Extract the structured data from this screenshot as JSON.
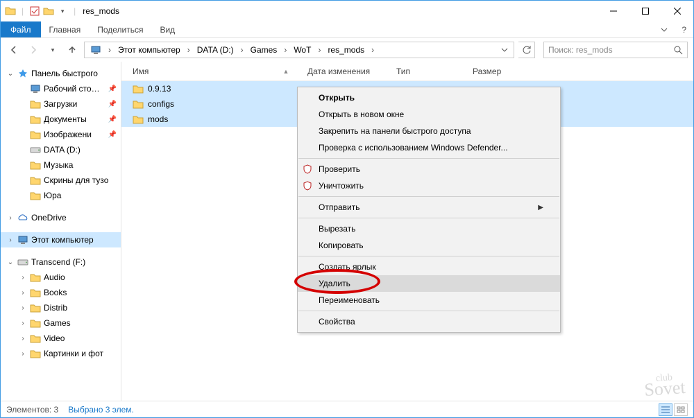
{
  "title": "res_mods",
  "ribbon": {
    "file": "Файл",
    "tabs": [
      "Главная",
      "Поделиться",
      "Вид"
    ]
  },
  "breadcrumbs": [
    "Этот компьютер",
    "DATA (D:)",
    "Games",
    "WoT",
    "res_mods"
  ],
  "search_placeholder": "Поиск: res_mods",
  "tree": {
    "quick": "Панель быстрого",
    "quick_items": [
      {
        "label": "Рабочий сто…",
        "type": "desktop",
        "pinned": true
      },
      {
        "label": "Загрузки",
        "type": "folder",
        "pinned": true
      },
      {
        "label": "Документы",
        "type": "folder",
        "pinned": true
      },
      {
        "label": "Изображени",
        "type": "folder",
        "pinned": true
      },
      {
        "label": "DATA (D:)",
        "type": "drive",
        "pinned": false
      },
      {
        "label": "Музыка",
        "type": "folder",
        "pinned": false
      },
      {
        "label": "Скрины для тузо",
        "type": "folder",
        "pinned": false
      },
      {
        "label": "Юра",
        "type": "folder",
        "pinned": false
      }
    ],
    "onedrive": "OneDrive",
    "thispc": "Этот компьютер",
    "transcend": "Transcend (F:)",
    "transcend_items": [
      "Audio",
      "Books",
      "Distrib",
      "Games",
      "Video",
      "Картинки и фот"
    ]
  },
  "columns": {
    "name": "Имя",
    "date": "Дата изменения",
    "type": "Тип",
    "size": "Размер"
  },
  "rows": [
    {
      "name": "0.9.13"
    },
    {
      "name": "configs"
    },
    {
      "name": "mods"
    }
  ],
  "ctx": {
    "open": "Открыть",
    "open_new": "Открыть в новом окне",
    "pin": "Закрепить на панели быстрого доступа",
    "defender": "Проверка с использованием Windows Defender...",
    "scan": "Проверить",
    "shred": "Уничтожить",
    "send": "Отправить",
    "cut": "Вырезать",
    "copy": "Копировать",
    "shortcut": "Создать ярлык",
    "delete": "Удалить",
    "rename": "Переименовать",
    "props": "Свойства"
  },
  "status": {
    "count": "Элементов: 3",
    "selected": "Выбрано 3 элем."
  }
}
